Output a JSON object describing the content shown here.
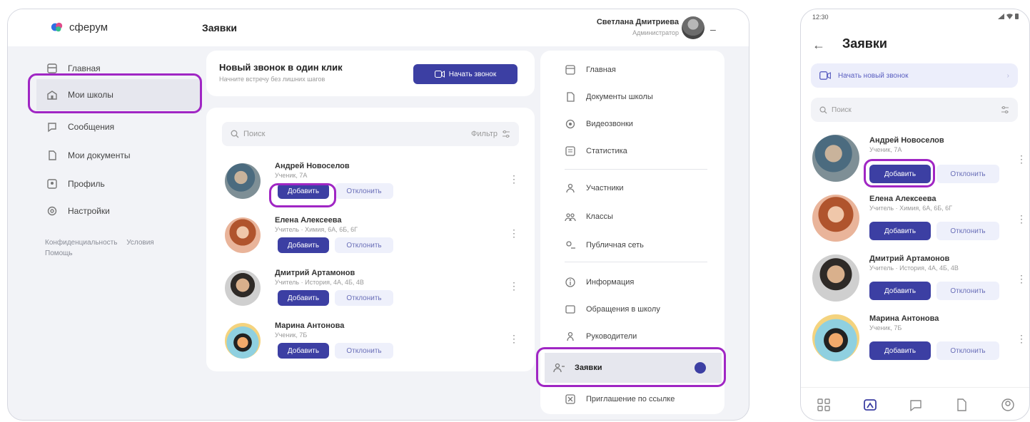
{
  "colors": {
    "accent": "#3c3fa3",
    "highlight": "#a026c4",
    "background": "#f2f3f7"
  },
  "desktop": {
    "logo_text": "сферум",
    "page_title": "Заявки",
    "user": {
      "name": "Светлана Дмитриева",
      "role": "Администратор"
    },
    "sidebar": [
      {
        "label": "Главная",
        "icon": "home-icon"
      },
      {
        "label": "Мои школы",
        "icon": "school-icon"
      },
      {
        "label": "Сообщения",
        "icon": "chat-icon"
      },
      {
        "label": "Мои документы",
        "icon": "document-icon"
      },
      {
        "label": "Профиль",
        "icon": "profile-icon"
      },
      {
        "label": "Настройки",
        "icon": "settings-icon"
      }
    ],
    "legal": [
      "Конфиденциальность",
      "Условия",
      "Помощь"
    ],
    "banner": {
      "title": "Новый звонок в один клик",
      "subtitle": "Начните встречу без лишних шагов",
      "button": "Начать звонок"
    },
    "search": {
      "placeholder": "Поиск",
      "filter_label": "Фильтр"
    },
    "requests": [
      {
        "name": "Андрей Новоселов",
        "sub": "Ученик, 7А",
        "add": "Добавить",
        "reject": "Отклонить"
      },
      {
        "name": "Елена Алексеева",
        "sub": "Учитель · Химия, 6А, 6Б, 6Г",
        "add": "Добавить",
        "reject": "Отклонить"
      },
      {
        "name": "Дмитрий Артамонов",
        "sub": "Учитель · История, 4А, 4Б, 4В",
        "add": "Добавить",
        "reject": "Отклонить"
      },
      {
        "name": "Марина Антонова",
        "sub": "Ученик, 7Б",
        "add": "Добавить",
        "reject": "Отклонить"
      }
    ],
    "menu": [
      {
        "label": "Главная",
        "icon": "home-icon"
      },
      {
        "label": "Документы школы",
        "icon": "folder-icon"
      },
      {
        "label": "Видеозвонки",
        "icon": "video-icon"
      },
      {
        "label": "Статистика",
        "icon": "stats-icon"
      },
      {
        "label": "Участники",
        "icon": "people-icon"
      },
      {
        "label": "Классы",
        "icon": "class-icon"
      },
      {
        "label": "Публичная сеть",
        "icon": "network-icon"
      },
      {
        "label": "Информация",
        "icon": "info-icon"
      },
      {
        "label": "Обращения в школу",
        "icon": "mail-icon"
      },
      {
        "label": "Руководители",
        "icon": "leader-icon"
      },
      {
        "label": "Заявки",
        "icon": "requests-icon"
      },
      {
        "label": "Приглашение по ссылке",
        "icon": "link-icon"
      }
    ]
  },
  "phone": {
    "time": "12:30",
    "title": "Заявки",
    "new_call": "Начать новый звонок",
    "search_placeholder": "Поиск",
    "requests": [
      {
        "name": "Андрей Новоселов",
        "sub": "Ученик, 7А",
        "add": "Добавить",
        "reject": "Отклонить"
      },
      {
        "name": "Елена Алексеева",
        "sub": "Учитель · Химия, 6А, 6Б, 6Г",
        "add": "Добавить",
        "reject": "Отклонить"
      },
      {
        "name": "Дмитрий Артамонов",
        "sub": "Учитель · История, 4А, 4Б, 4В",
        "add": "Добавить",
        "reject": "Отклонить"
      },
      {
        "name": "Марина Антонова",
        "sub": "Ученик, 7Б",
        "add": "Добавить",
        "reject": "Отклонить"
      }
    ]
  }
}
